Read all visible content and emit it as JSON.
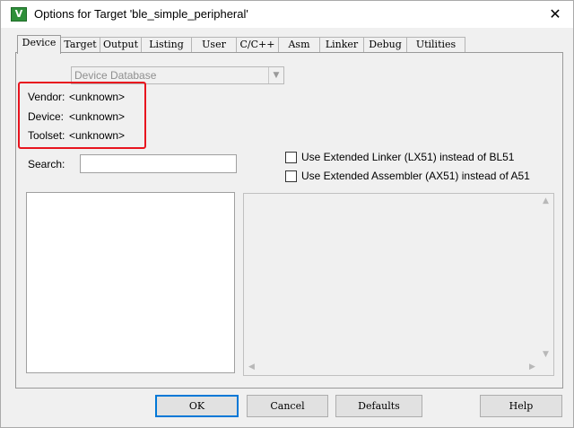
{
  "window": {
    "title": "Options for Target 'ble_simple_peripheral'",
    "icon_letter": "V",
    "close_glyph": "✕"
  },
  "tabs": [
    {
      "label": "Device",
      "active": true
    },
    {
      "label": "Target"
    },
    {
      "label": "Output"
    },
    {
      "label": "Listing"
    },
    {
      "label": "User"
    },
    {
      "label": "C/C++"
    },
    {
      "label": "Asm"
    },
    {
      "label": "Linker"
    },
    {
      "label": "Debug"
    },
    {
      "label": "Utilities"
    }
  ],
  "device": {
    "database_select": "Device Database",
    "vendor_label": "Vendor:",
    "vendor_value": "<unknown>",
    "device_label": "Device:",
    "device_value": "<unknown>",
    "toolset_label": "Toolset:",
    "toolset_value": "<unknown>",
    "search_label": "Search:",
    "search_value": "",
    "options": [
      {
        "label": "Use Extended Linker (LX51) instead of BL51",
        "checked": false
      },
      {
        "label": "Use Extended Assembler (AX51) instead of A51",
        "checked": false
      }
    ],
    "highlight_color": "#e8141e"
  },
  "footer": {
    "ok": "OK",
    "cancel": "Cancel",
    "defaults": "Defaults",
    "help": "Help"
  },
  "colors": {
    "window_bg": "#f0f0f0",
    "focus_border": "#0078d7"
  }
}
